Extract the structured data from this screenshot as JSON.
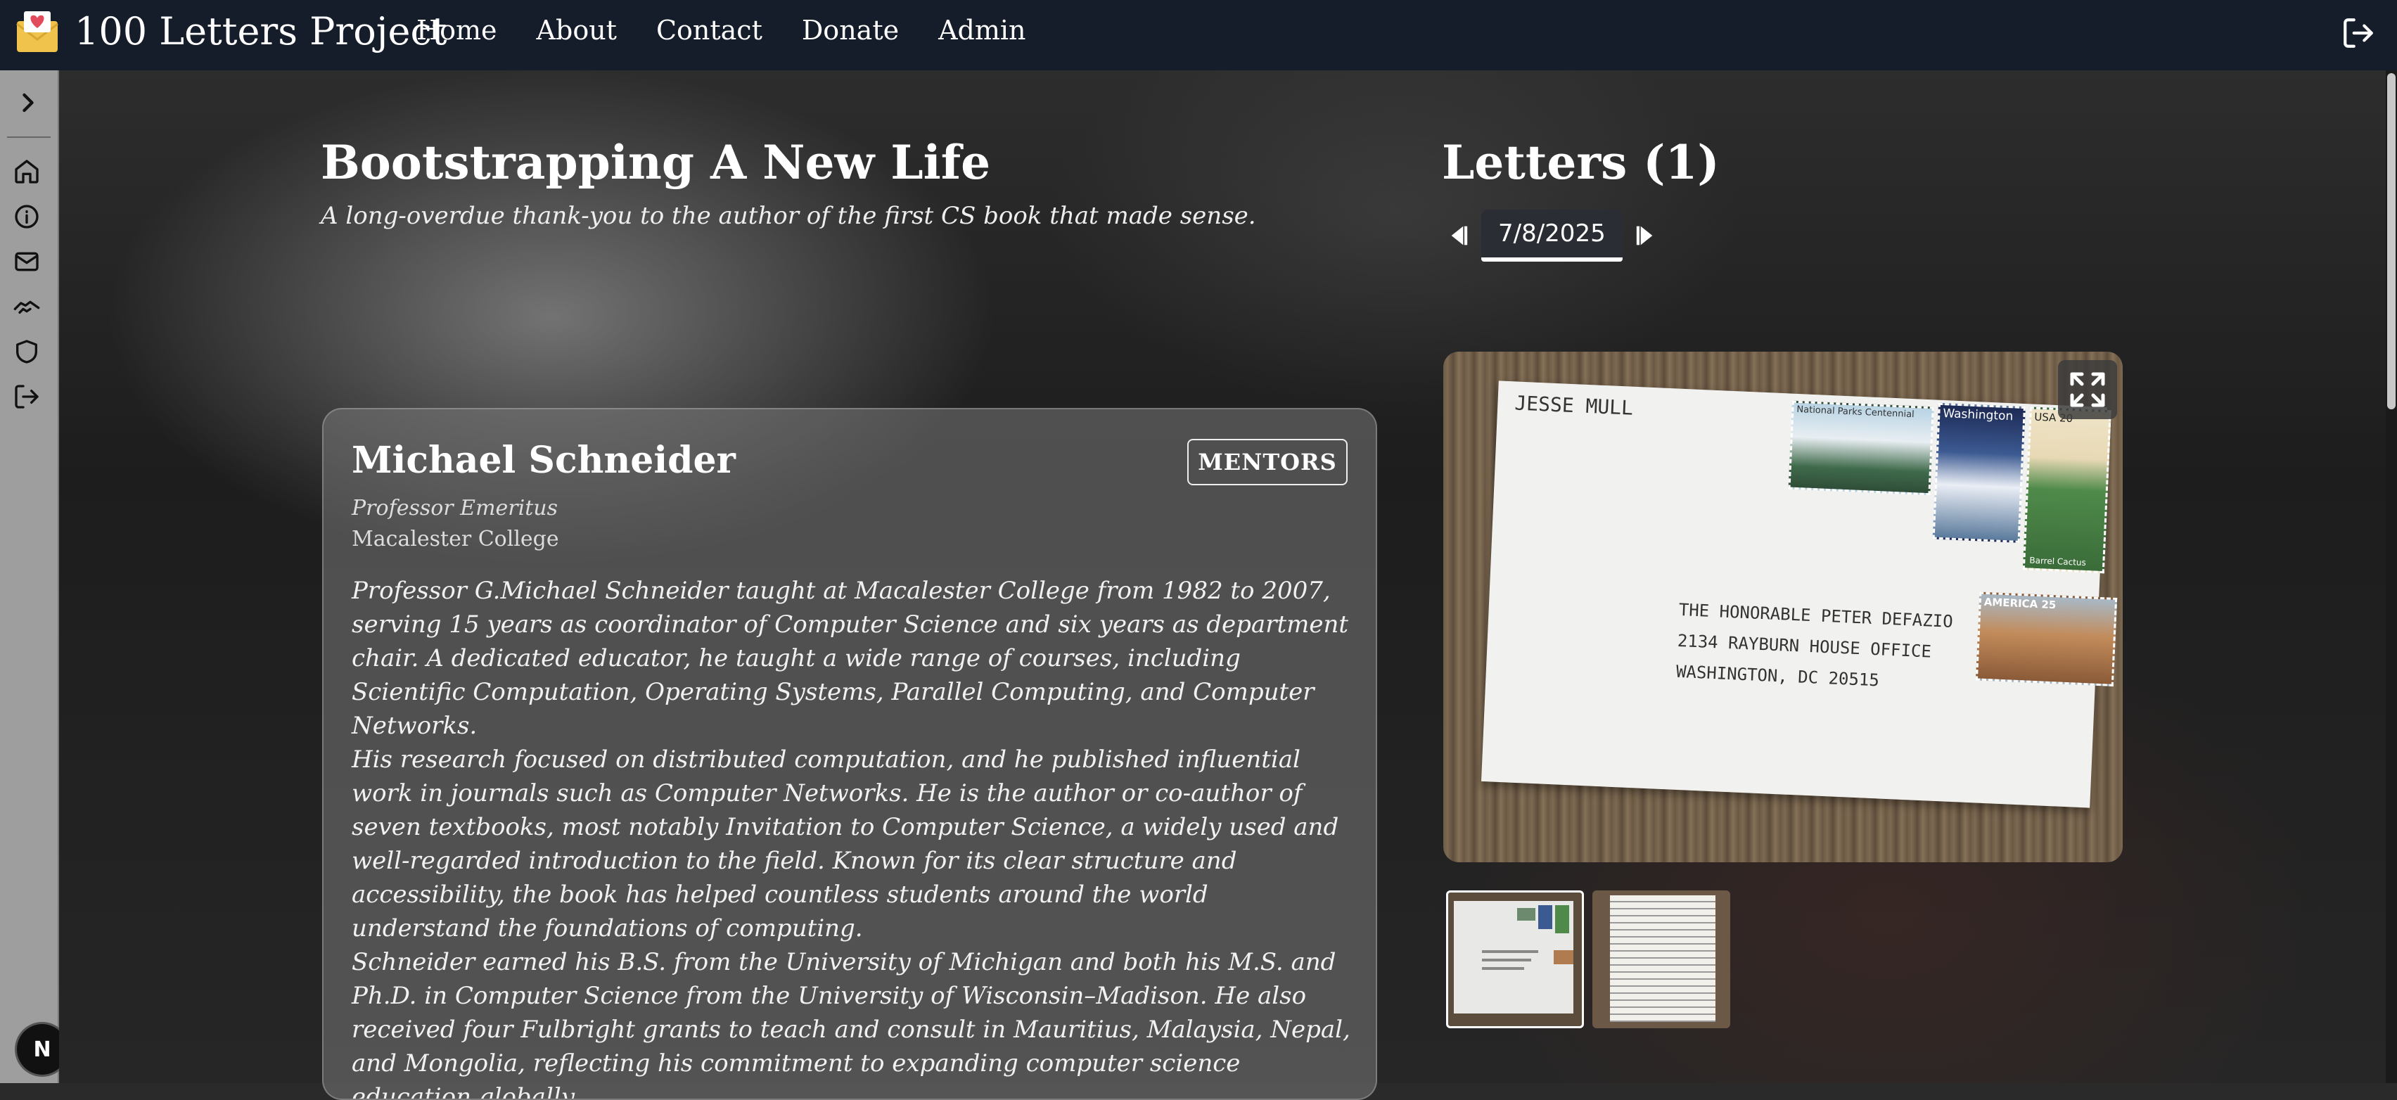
{
  "nav": {
    "brand": "100 Letters Project",
    "links": [
      "Home",
      "About",
      "Contact",
      "Donate",
      "Admin"
    ]
  },
  "sidebar": {
    "icons": [
      "chevron-right-icon",
      "home-icon",
      "info-icon",
      "mail-icon",
      "handshake-icon",
      "shield-icon",
      "logout-icon"
    ],
    "badge": "N"
  },
  "page": {
    "title": "Bootstrapping A New Life",
    "subtitle": "A long-overdue thank-you to the author of the first CS book that made sense."
  },
  "recipient": {
    "name": "Michael Schneider",
    "category": "MENTORS",
    "role": "Professor Emeritus",
    "organization": "Macalester College",
    "bio": [
      "Professor G.Michael Schneider taught at Macalester College from 1982 to 2007, serving 15 years as coordinator of Computer Science and six years as department chair. A dedicated educator, he taught a wide range of courses, including Scientific Computation, Operating Systems, Parallel Computing, and Computer Networks.",
      "His research focused on distributed computation, and he published influential work in journals such as Computer Networks. He is the author or co-author of seven textbooks, most notably Invitation to Computer Science, a widely used and well-regarded introduction to the field. Known for its clear structure and accessibility, the book has helped countless students around the world understand the foundations of computing.",
      "Schneider earned his B.S. from the University of Michigan and both his M.S. and Ph.D. in Computer Science from the University of Wisconsin–Madison. He also received four Fulbright grants to teach and consult in Mauritius, Malaysia, Nepal, and Mongolia, reflecting his commitment to expanding computer science education globally."
    ]
  },
  "letters": {
    "title": "Letters (1)",
    "current_date": "7/8/2025",
    "envelope": {
      "sender": "JESSE MULL",
      "address_lines": [
        "THE HONORABLE PETER DEFAZIO",
        "2134 RAYBURN HOUSE OFFICE",
        "WASHINGTON, DC 20515"
      ],
      "stamps": [
        "National Parks Centennial",
        "Washington",
        "USA 20",
        "Barrel Cactus",
        "AMERICA 25"
      ]
    }
  }
}
